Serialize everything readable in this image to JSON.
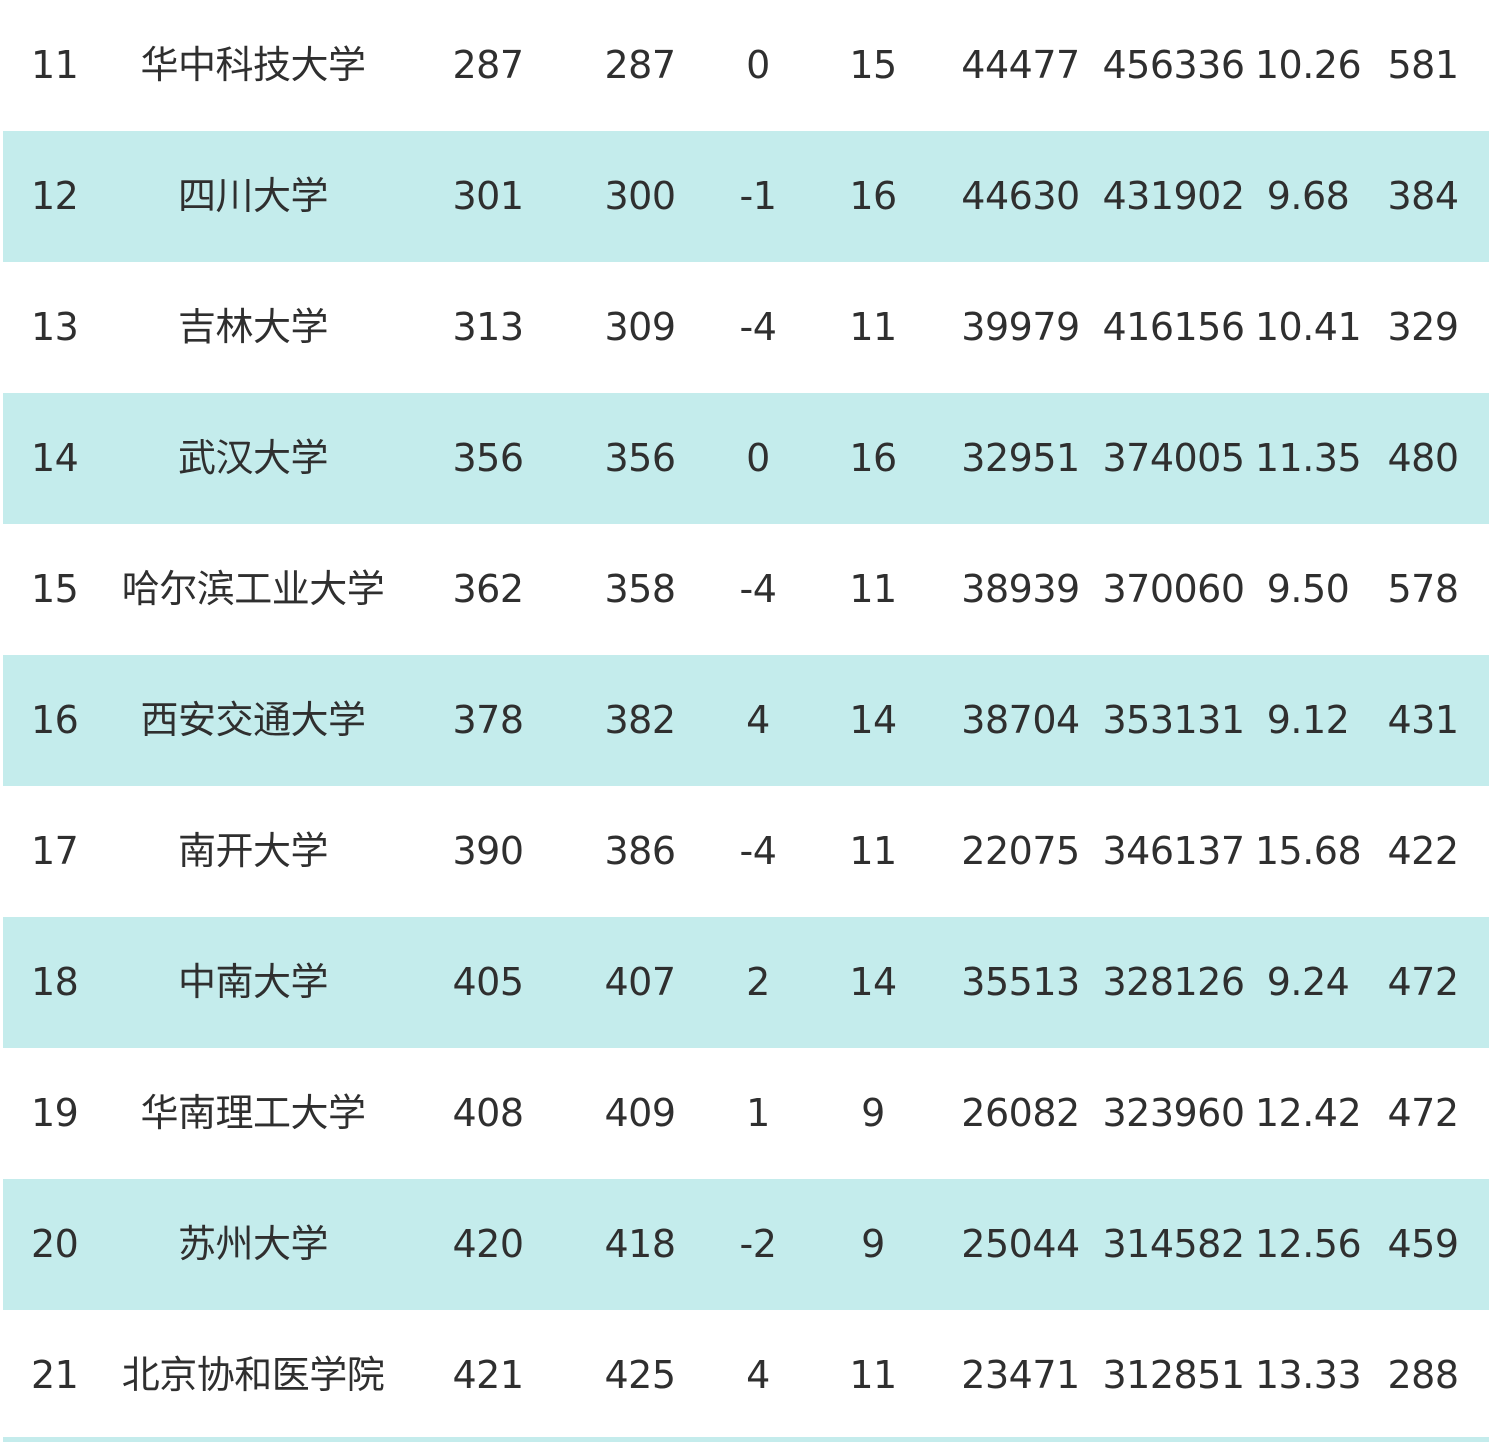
{
  "rows": [
    {
      "rank": "11",
      "name": "华中科技大学",
      "v1": "287",
      "v2": "287",
      "change": "0",
      "v3": "15",
      "v4": "44477",
      "v5": "456336",
      "v6": "10.26",
      "v7": "581"
    },
    {
      "rank": "12",
      "name": "四川大学",
      "v1": "301",
      "v2": "300",
      "change": "-1",
      "v3": "16",
      "v4": "44630",
      "v5": "431902",
      "v6": "9.68",
      "v7": "384"
    },
    {
      "rank": "13",
      "name": "吉林大学",
      "v1": "313",
      "v2": "309",
      "change": "-4",
      "v3": "11",
      "v4": "39979",
      "v5": "416156",
      "v6": "10.41",
      "v7": "329"
    },
    {
      "rank": "14",
      "name": "武汉大学",
      "v1": "356",
      "v2": "356",
      "change": "0",
      "v3": "16",
      "v4": "32951",
      "v5": "374005",
      "v6": "11.35",
      "v7": "480"
    },
    {
      "rank": "15",
      "name": "哈尔滨工业大学",
      "v1": "362",
      "v2": "358",
      "change": "-4",
      "v3": "11",
      "v4": "38939",
      "v5": "370060",
      "v6": "9.50",
      "v7": "578"
    },
    {
      "rank": "16",
      "name": "西安交通大学",
      "v1": "378",
      "v2": "382",
      "change": "4",
      "v3": "14",
      "v4": "38704",
      "v5": "353131",
      "v6": "9.12",
      "v7": "431"
    },
    {
      "rank": "17",
      "name": "南开大学",
      "v1": "390",
      "v2": "386",
      "change": "-4",
      "v3": "11",
      "v4": "22075",
      "v5": "346137",
      "v6": "15.68",
      "v7": "422"
    },
    {
      "rank": "18",
      "name": "中南大学",
      "v1": "405",
      "v2": "407",
      "change": "2",
      "v3": "14",
      "v4": "35513",
      "v5": "328126",
      "v6": "9.24",
      "v7": "472"
    },
    {
      "rank": "19",
      "name": "华南理工大学",
      "v1": "408",
      "v2": "409",
      "change": "1",
      "v3": "9",
      "v4": "26082",
      "v5": "323960",
      "v6": "12.42",
      "v7": "472"
    },
    {
      "rank": "20",
      "name": "苏州大学",
      "v1": "420",
      "v2": "418",
      "change": "-2",
      "v3": "9",
      "v4": "25044",
      "v5": "314582",
      "v6": "12.56",
      "v7": "459"
    },
    {
      "rank": "21",
      "name": "北京协和医学院",
      "v1": "421",
      "v2": "425",
      "change": "4",
      "v3": "11",
      "v4": "23471",
      "v5": "312851",
      "v6": "13.33",
      "v7": "288"
    }
  ],
  "colors": {
    "shaded_row": "#c4ecec",
    "text": "#2f2f2f",
    "background": "#ffffff"
  }
}
